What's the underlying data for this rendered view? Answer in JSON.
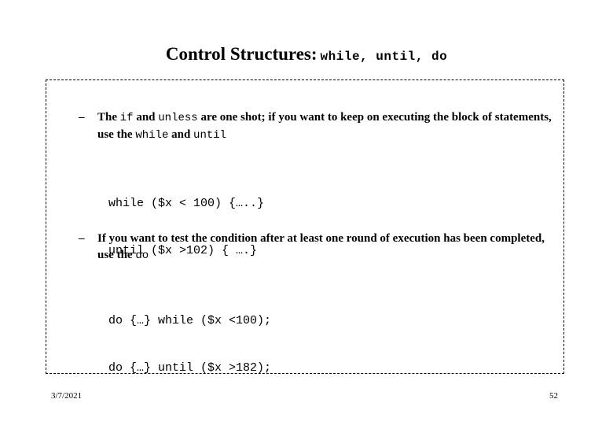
{
  "slide": {
    "title": {
      "main": "Control Structures:",
      "code": "while, until, do"
    },
    "bullets": [
      {
        "marker": "–",
        "segments": [
          {
            "type": "text",
            "value": "The "
          },
          {
            "type": "code",
            "value": "if"
          },
          {
            "type": "text",
            "value": " and "
          },
          {
            "type": "code",
            "value": "unless"
          },
          {
            "type": "text",
            "value": " are one shot; if you want to keep on executing the block of statements, use the "
          },
          {
            "type": "code",
            "value": "while"
          },
          {
            "type": "text",
            "value": " and "
          },
          {
            "type": "code",
            "value": "until"
          }
        ]
      },
      {
        "marker": "–",
        "segments": [
          {
            "type": "text",
            "value": "If you want to test the condition after at least one round of execution has been completed, use the "
          },
          {
            "type": "code",
            "value": "do"
          }
        ]
      }
    ],
    "code_blocks": [
      {
        "lines": [
          "while ($x < 100) {…..}",
          "until ($x >102) { ….}"
        ]
      },
      {
        "lines": [
          "do {…} while ($x <100);",
          "do {…} until ($x >182);"
        ]
      }
    ],
    "footer": {
      "date": "3/7/2021",
      "page_number": "52"
    },
    "colors": {
      "background": "#ffffff",
      "text": "#000000",
      "frame_border": "#000000"
    }
  }
}
